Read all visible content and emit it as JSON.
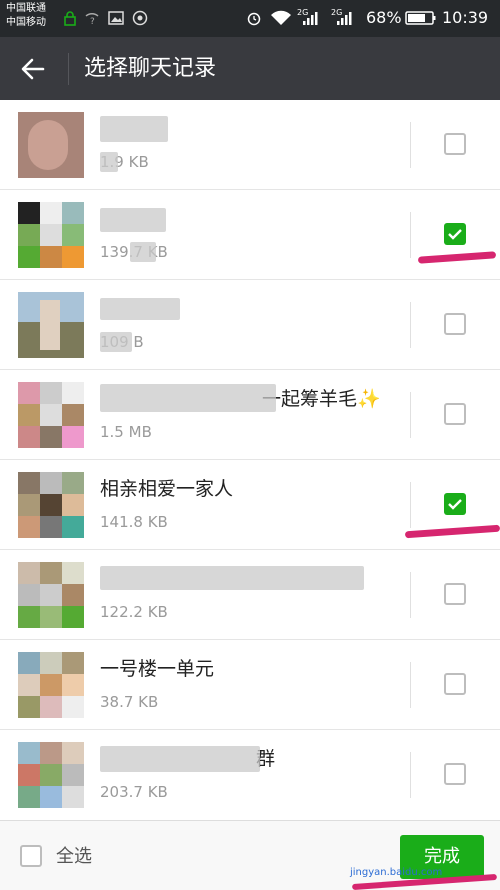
{
  "status_bar": {
    "carrier1": "中国联通",
    "carrier2": "中国移动",
    "signal_label_a": "2G",
    "signal_label_b": "2G",
    "battery": "68%",
    "time": "10:39"
  },
  "app_bar": {
    "title": "选择聊天记录"
  },
  "chats": [
    {
      "name": "",
      "size": "1.9 KB",
      "checked": false
    },
    {
      "name": "",
      "size": "139.7 KB",
      "checked": true
    },
    {
      "name": "",
      "size": "109 B",
      "checked": false
    },
    {
      "name": "一起筹羊毛✨",
      "size": "1.5 MB",
      "checked": false
    },
    {
      "name": "相亲相爱一家人",
      "size": "141.8 KB",
      "checked": true
    },
    {
      "name": "",
      "size": "122.2 KB",
      "checked": false
    },
    {
      "name": "一号楼一单元",
      "size": "38.7 KB",
      "checked": false
    },
    {
      "name": "群",
      "size": "203.7 KB",
      "checked": false
    }
  ],
  "bottom_bar": {
    "select_all_label": "全选",
    "done_label": "完成"
  },
  "watermark": "jingyan.baidu.com",
  "colors": {
    "accent": "#1aad19",
    "annotation": "#d6266f"
  }
}
